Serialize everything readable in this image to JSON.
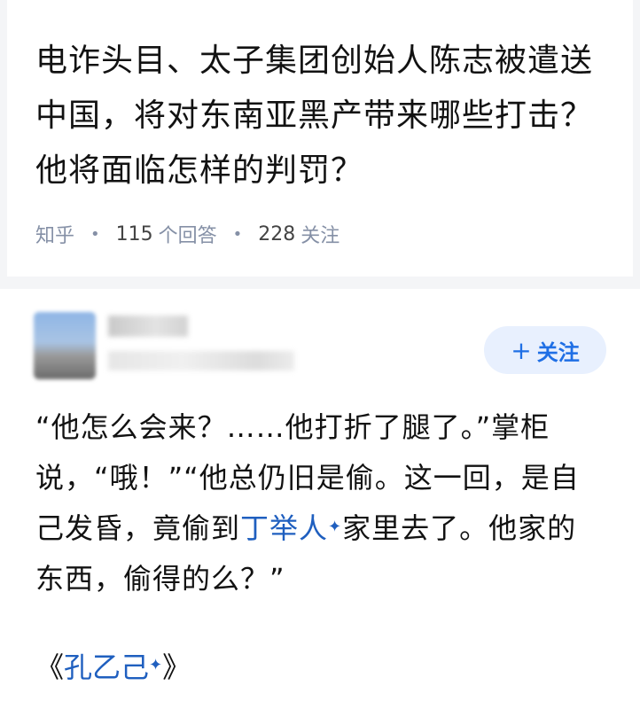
{
  "question": {
    "title": "电诈头目、太子集团创始人陈志被遣送中国，将对东南亚黑产带来哪些打击？他将面临怎样的判罚？",
    "source": "知乎",
    "answers_count": "115",
    "answers_label": "个回答",
    "followers_count": "228",
    "followers_label": "关注"
  },
  "answer": {
    "author_name": "",
    "author_bio": "",
    "follow_button_label": "关注",
    "follow_button_icon": "plus-icon",
    "body_part1": "“他怎么会来？……他打折了腿了。”掌柜说，“哦！”“他总仍旧是偷。这一回，是自己发昏，竟偷到",
    "body_link": "丁举人",
    "body_part2": "家里去了。他家的东西，偷得的么？”",
    "book_open": "《",
    "book_link": "孔乙己",
    "book_close": "》",
    "spark_icon": "✦"
  },
  "colors": {
    "page_background": "#f4f5f7",
    "card_background": "#ffffff",
    "link_blue": "#1f5fbf",
    "follow_button_bg": "#e8f0fe",
    "follow_button_text": "#1f6fe5",
    "meta_gray": "#8590a6"
  }
}
